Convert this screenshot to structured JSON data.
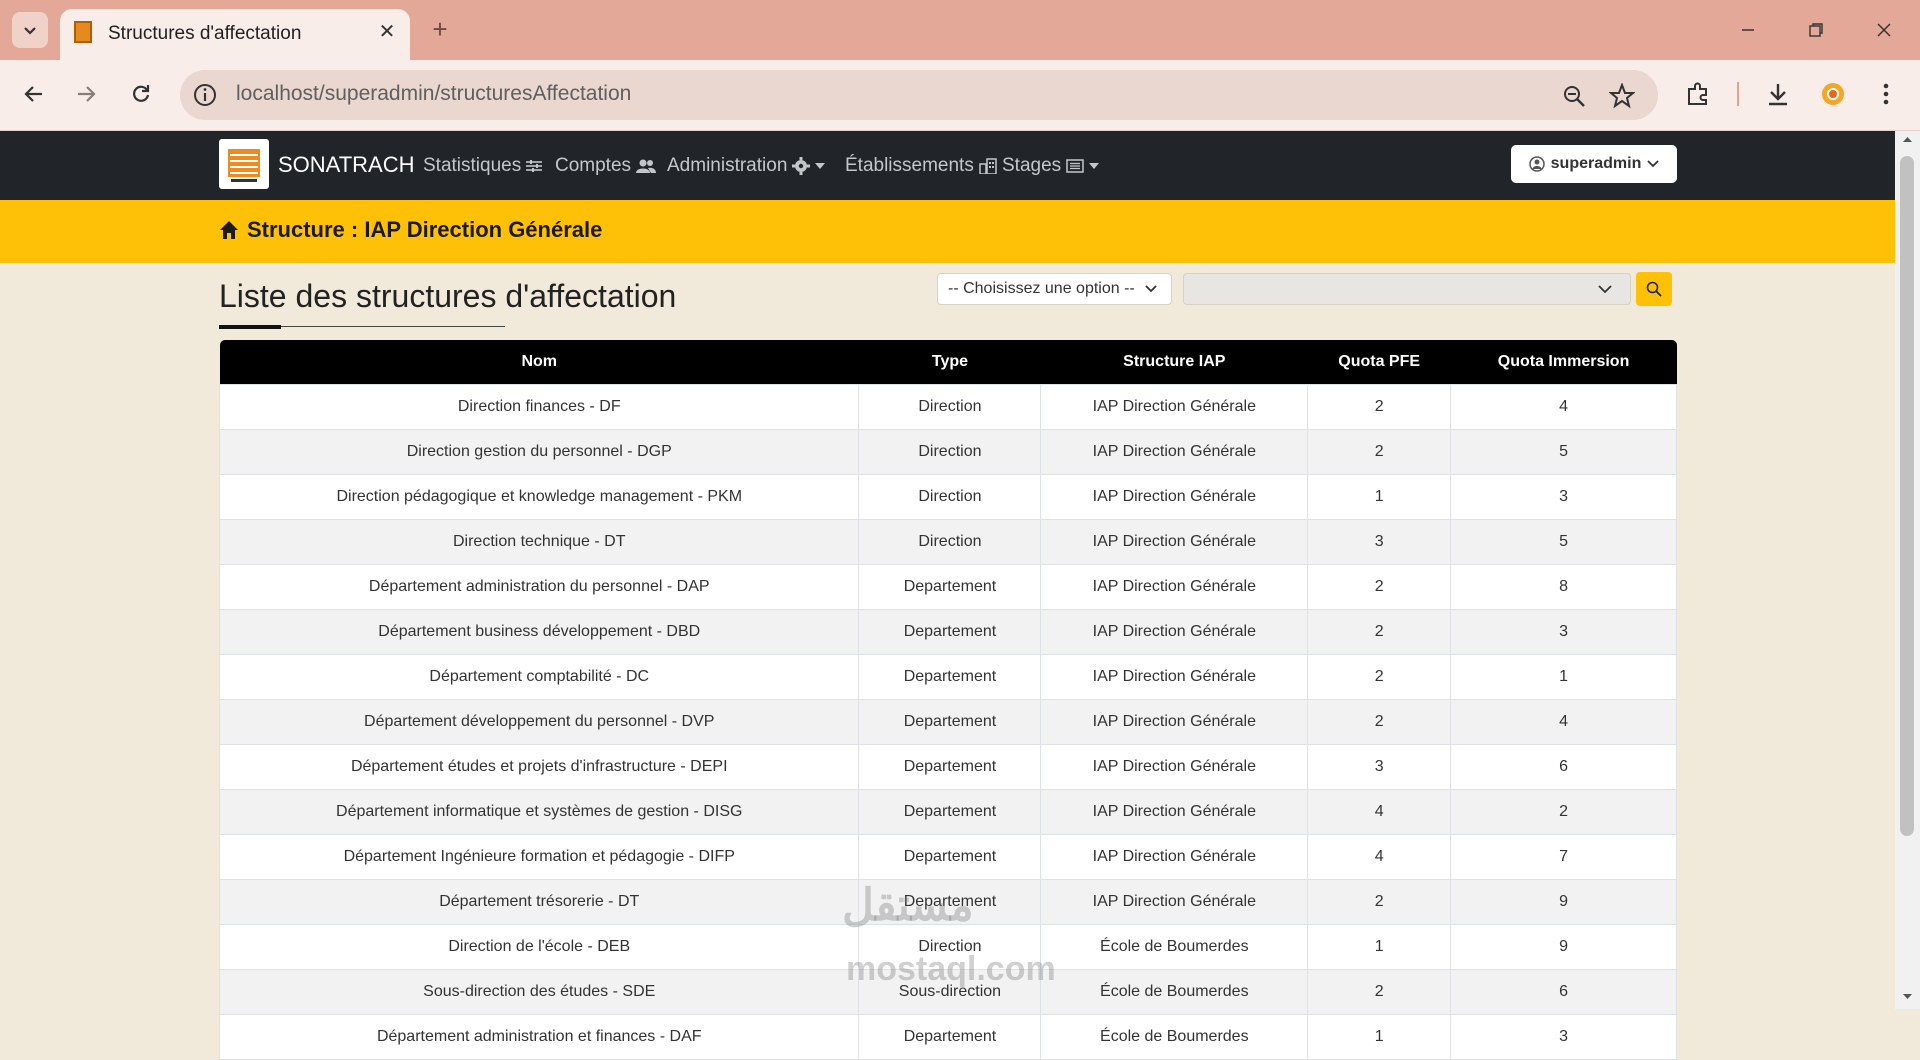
{
  "browser": {
    "tab_title": "Structures d'affectation",
    "url": "localhost/superadmin/structuresAffectation"
  },
  "navbar": {
    "brand": "SONATRACH",
    "links": [
      "Statistiques",
      "Comptes",
      "Administration",
      "Établissements",
      "Stages"
    ],
    "user": "superadmin"
  },
  "banner": {
    "title": "Structure : IAP Direction Générale"
  },
  "page": {
    "title": "Liste des structures d'affectation",
    "filter_placeholder": "-- Choisissez une option --"
  },
  "table": {
    "headers": [
      "Nom",
      "Type",
      "Structure IAP",
      "Quota PFE",
      "Quota Immersion"
    ],
    "rows": [
      [
        "Direction finances - DF",
        "Direction",
        "IAP Direction Générale",
        "2",
        "4"
      ],
      [
        "Direction gestion du personnel - DGP",
        "Direction",
        "IAP Direction Générale",
        "2",
        "5"
      ],
      [
        "Direction pédagogique et knowledge management - PKM",
        "Direction",
        "IAP Direction Générale",
        "1",
        "3"
      ],
      [
        "Direction technique - DT",
        "Direction",
        "IAP Direction Générale",
        "3",
        "5"
      ],
      [
        "Département administration du personnel - DAP",
        "Departement",
        "IAP Direction Générale",
        "2",
        "8"
      ],
      [
        "Département business développement - DBD",
        "Departement",
        "IAP Direction Générale",
        "2",
        "3"
      ],
      [
        "Département comptabilité - DC",
        "Departement",
        "IAP Direction Générale",
        "2",
        "1"
      ],
      [
        "Département développement du personnel - DVP",
        "Departement",
        "IAP Direction Générale",
        "2",
        "4"
      ],
      [
        "Département études et projets d'infrastructure - DEPI",
        "Departement",
        "IAP Direction Générale",
        "3",
        "6"
      ],
      [
        "Département informatique et systèmes de gestion - DISG",
        "Departement",
        "IAP Direction Générale",
        "4",
        "2"
      ],
      [
        "Département Ingénieure formation et pédagogie - DIFP",
        "Departement",
        "IAP Direction Générale",
        "4",
        "7"
      ],
      [
        "Département trésorerie - DT",
        "Departement",
        "IAP Direction Générale",
        "2",
        "9"
      ],
      [
        "Direction de l'école - DEB",
        "Direction",
        "École de Boumerdes",
        "1",
        "9"
      ],
      [
        "Sous-direction des études - SDE",
        "Sous-direction",
        "École de Boumerdes",
        "2",
        "6"
      ],
      [
        "Département administration et finances - DAF",
        "Departement",
        "École de Boumerdes",
        "1",
        "3"
      ]
    ]
  },
  "watermark": {
    "arabic": "مستقل",
    "latin": "mostaql.com"
  },
  "colors": {
    "accent": "#ffc107",
    "navbar": "#212529",
    "page_bg": "#f1eadb"
  }
}
